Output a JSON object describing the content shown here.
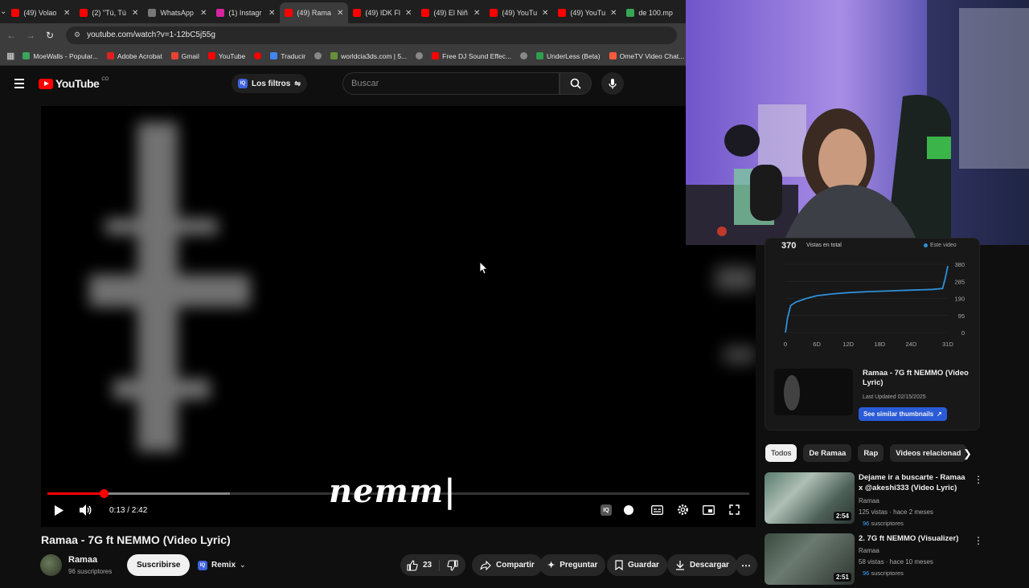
{
  "browser": {
    "tabs": [
      {
        "title": "(49) Volao",
        "color": "#ff0000",
        "active": false
      },
      {
        "title": "(2) \"Tú, Tú",
        "color": "#ff0000",
        "active": false
      },
      {
        "title": "WhatsApp",
        "color": "#777777",
        "active": false
      },
      {
        "title": "(1) Instagr",
        "color": "#d6249f",
        "active": false
      },
      {
        "title": "(49) Rama",
        "color": "#ff0000",
        "active": true
      },
      {
        "title": "(49) IDK Fl",
        "color": "#ff0000",
        "active": false
      },
      {
        "title": "(49) El Niñ",
        "color": "#ff0000",
        "active": false
      },
      {
        "title": "(49) YouTu",
        "color": "#ff0000",
        "active": false
      },
      {
        "title": "(49) YouTu",
        "color": "#ff0000",
        "active": false
      },
      {
        "title": "de 100.mp",
        "color": "#34a853",
        "active": false
      }
    ],
    "url": "youtube.com/watch?v=1-12bC5j55g",
    "bookmarks": [
      {
        "label": "MoeWalls - Popular...",
        "color": "#3aa55c"
      },
      {
        "label": "Adobe Acrobat",
        "color": "#e02020"
      },
      {
        "label": "Gmail",
        "color": "#ea4335"
      },
      {
        "label": "YouTube",
        "color": "#ff0000"
      },
      {
        "label": "",
        "color": "#ff0000"
      },
      {
        "label": "Traducir",
        "color": "#4285f4"
      },
      {
        "label": "",
        "color": "#888888"
      },
      {
        "label": "worldcia3ds.com | 5...",
        "color": "#6a8f3a"
      },
      {
        "label": "",
        "color": "#888888"
      },
      {
        "label": "Free DJ Sound Effec...",
        "color": "#ff0000"
      },
      {
        "label": "",
        "color": "#888888"
      },
      {
        "label": "UnderLess (Beta)",
        "color": "#2e9e4f"
      },
      {
        "label": "OmeTV Video Chat...",
        "color": "#ff5a3c"
      }
    ]
  },
  "youtube": {
    "logo_text": "YouTube",
    "region": "CO",
    "filters_label": "Los filtros",
    "search_placeholder": "Buscar"
  },
  "player": {
    "lyric_text": "nemm|",
    "current_time": "0:13 / 2:42",
    "progress_fraction": 0.0802,
    "buffer_fraction": 0.26
  },
  "video": {
    "title": "Ramaa - 7G ft NEMMO (Video Lyric)",
    "channel": "Ramaa",
    "subscribers": "96 suscriptores",
    "subscribe_label": "Suscribirse",
    "remix_label": "Remix",
    "likes": "23",
    "share_label": "Compartir",
    "ask_label": "Preguntar",
    "save_label": "Guardar",
    "download_label": "Descargar"
  },
  "stats_panel": {
    "views_total": "370",
    "views_label": "Vistas en total",
    "legend_label": "Este video",
    "thumb_title": "Ramaa - 7G ft NEMMO (Video Lyric)",
    "thumb_updated": "Last Updated 02/15/2025",
    "similar_label": "See similar thumbnails"
  },
  "chart_data": {
    "type": "line",
    "x_ticks": [
      "0",
      "6D",
      "12D",
      "18D",
      "24D",
      "31D"
    ],
    "y_ticks": [
      "380",
      "285",
      "190",
      "95",
      "0"
    ],
    "ylim": [
      0,
      380
    ],
    "xlim": [
      0,
      31
    ],
    "series": [
      {
        "name": "Este video",
        "color": "#2f8fd8",
        "points": [
          [
            0,
            0
          ],
          [
            0.4,
            80
          ],
          [
            1,
            150
          ],
          [
            2,
            170
          ],
          [
            4,
            190
          ],
          [
            6,
            205
          ],
          [
            9,
            215
          ],
          [
            12,
            222
          ],
          [
            16,
            228
          ],
          [
            20,
            232
          ],
          [
            24,
            236
          ],
          [
            28,
            240
          ],
          [
            30,
            245
          ],
          [
            30.5,
            300
          ],
          [
            31,
            370
          ]
        ]
      }
    ]
  },
  "chips": [
    "Todos",
    "De Ramaa",
    "Rap",
    "Videos relacionad"
  ],
  "recommendations": [
    {
      "title": "Dejame ir a buscarte - Ramaa x @akeshi333 (Video Lyric)",
      "channel": "Ramaa",
      "meta": "125 vistas · hace 2 meses",
      "subs_count": "96",
      "subs_label": "suscriptores",
      "duration": "2:54"
    },
    {
      "title": "2. 7G ft NEMMO (Visualizer)",
      "channel": "Ramaa",
      "meta": "58 vistas · hace 10 meses",
      "subs_count": "96",
      "subs_label": "suscriptores",
      "duration": "2:51"
    }
  ]
}
